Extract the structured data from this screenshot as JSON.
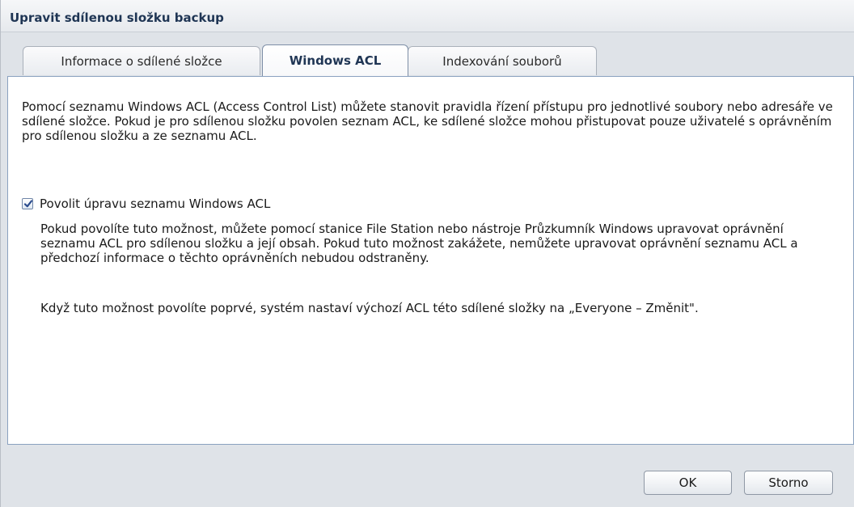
{
  "dialog": {
    "title": "Upravit sdílenou složku backup"
  },
  "tabs": [
    {
      "label": "Informace o sdílené složce",
      "active": false
    },
    {
      "label": "Windows ACL",
      "active": true
    },
    {
      "label": "Indexování souborů",
      "active": false
    }
  ],
  "content": {
    "description": "Pomocí seznamu Windows ACL (Access Control List) můžete stanovit pravidla řízení přístupu pro jednotlivé soubory nebo adresáře ve sdílené složce. Pokud je pro sdílenou složku povolen seznam ACL, ke sdílené složce mohou přistupovat pouze uživatelé s oprávněním pro sdílenou složku a ze seznamu ACL.",
    "checkbox": {
      "label": "Povolit úpravu seznamu Windows ACL",
      "checked": true
    },
    "note1": "Pokud povolíte tuto možnost, můžete pomocí stanice File Station nebo nástroje Průzkumník Windows upravovat oprávnění seznamu ACL pro sdílenou složku a její obsah. Pokud tuto možnost zakážete, nemůžete upravovat oprávnění seznamu ACL a předchozí informace o těchto oprávněních nebudou odstraněny.",
    "note2": "Když tuto možnost povolíte poprvé, systém nastaví výchozí ACL této sdílené složky na „Everyone – Změnit\"."
  },
  "footer": {
    "ok_label": "OK",
    "cancel_label": "Storno"
  }
}
